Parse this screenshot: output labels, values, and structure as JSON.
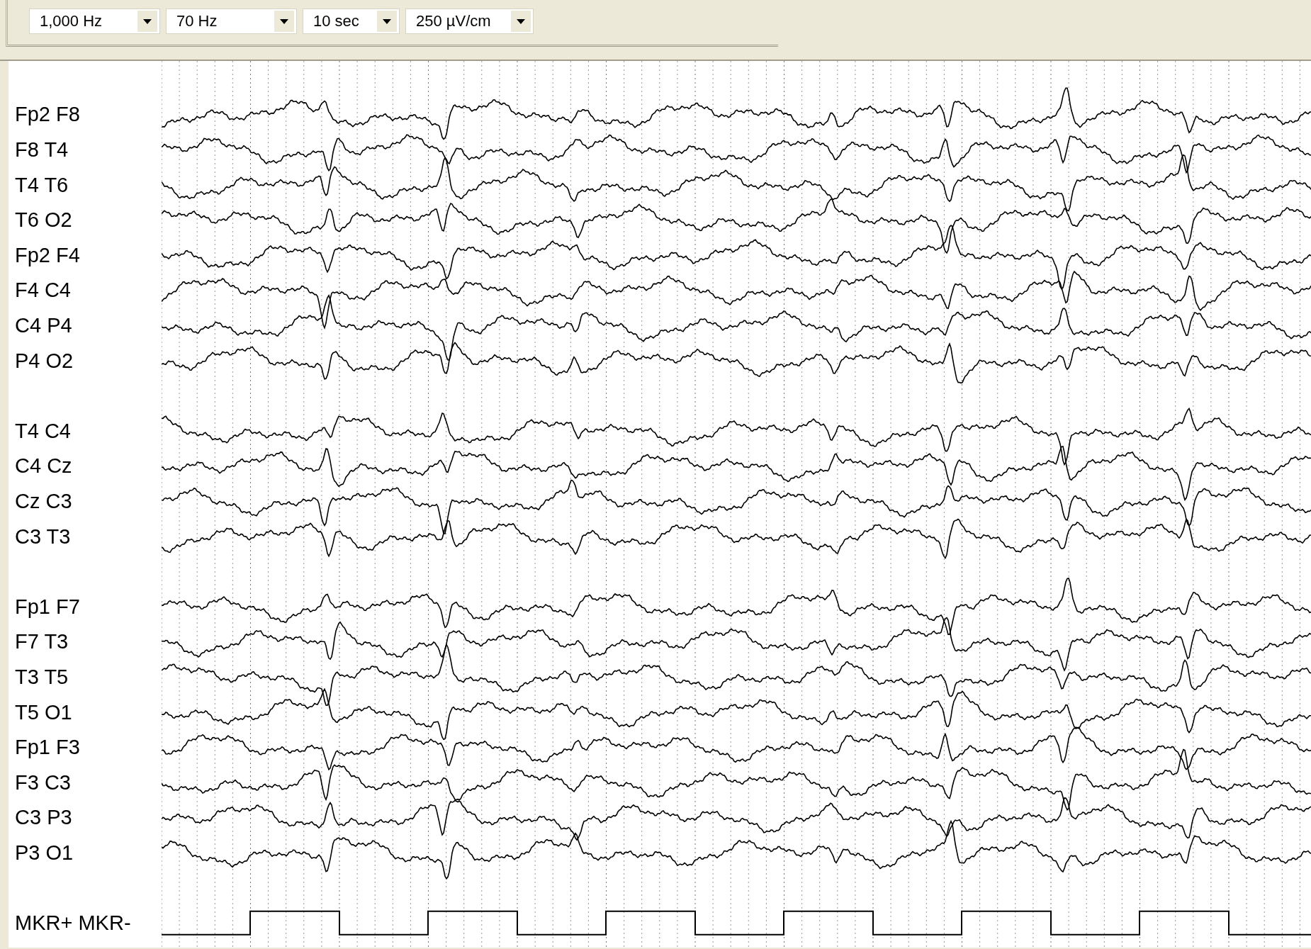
{
  "toolbar": {
    "dropdowns": [
      {
        "value": "1,000 Hz"
      },
      {
        "value": "70 Hz"
      },
      {
        "value": "10 sec"
      },
      {
        "value": "250 µV/cm"
      }
    ]
  },
  "montage": {
    "groups": [
      {
        "channels": [
          {
            "label": "Fp2 F8"
          },
          {
            "label": "F8 T4"
          },
          {
            "label": "T4 T6"
          },
          {
            "label": "T6 O2"
          },
          {
            "label": "Fp2 F4"
          },
          {
            "label": "F4 C4"
          },
          {
            "label": "C4 P4"
          },
          {
            "label": "P4 O2"
          }
        ]
      },
      {
        "channels": [
          {
            "label": "T4 C4"
          },
          {
            "label": "C4 Cz"
          },
          {
            "label": "Cz C3"
          },
          {
            "label": "C3 T3"
          }
        ]
      },
      {
        "channels": [
          {
            "label": "Fp1 F7"
          },
          {
            "label": "F7 T3"
          },
          {
            "label": "T3 T5"
          },
          {
            "label": "T5 O1"
          },
          {
            "label": "Fp1 F3"
          },
          {
            "label": "F3 C3"
          },
          {
            "label": "C3 P3"
          },
          {
            "label": "P3 O1"
          }
        ]
      }
    ]
  },
  "marker_channel": {
    "label": "MKR+ MKR-"
  }
}
